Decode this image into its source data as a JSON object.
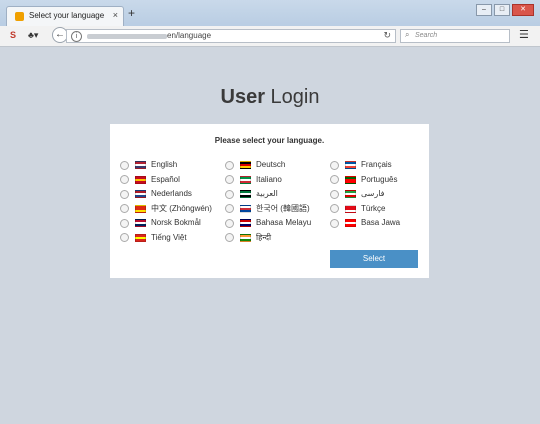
{
  "browser": {
    "tab_title": "Select your language",
    "tab_close": "×",
    "new_tab": "+",
    "url_path": "en/language",
    "search_placeholder": "Search",
    "win_min": "–",
    "win_max": "□",
    "win_close": "✕"
  },
  "page": {
    "title_bold": "User",
    "title_rest": " Login",
    "prompt": "Please select your language.",
    "select_button": "Select"
  },
  "languages": [
    {
      "label": "English",
      "flag": [
        "#b22234",
        "#ffffff",
        "#3c3b6e"
      ]
    },
    {
      "label": "Español",
      "flag": [
        "#c60b1e",
        "#ffc400",
        "#c60b1e"
      ]
    },
    {
      "label": "Nederlands",
      "flag": [
        "#ae1c28",
        "#ffffff",
        "#21468b"
      ]
    },
    {
      "label": "中文 (Zhōngwén)",
      "flag": [
        "#de2910",
        "#de2910",
        "#ffde00"
      ]
    },
    {
      "label": "Norsk Bokmål",
      "flag": [
        "#ba0c2f",
        "#ffffff",
        "#00205b"
      ]
    },
    {
      "label": "Tiếng Việt",
      "flag": [
        "#da251d",
        "#ffff00",
        "#da251d"
      ]
    },
    {
      "label": "Deutsch",
      "flag": [
        "#000000",
        "#dd0000",
        "#ffce00"
      ]
    },
    {
      "label": "Italiano",
      "flag": [
        "#009246",
        "#ffffff",
        "#ce2b37"
      ]
    },
    {
      "label": "العربية",
      "flag": [
        "#007a3d",
        "#ffffff",
        "#000000"
      ]
    },
    {
      "label": "한국어 (韓國語)",
      "flag": [
        "#ffffff",
        "#cd2e3a",
        "#0047a0"
      ]
    },
    {
      "label": "Bahasa Melayu",
      "flag": [
        "#cc0001",
        "#ffffff",
        "#010066"
      ]
    },
    {
      "label": "हिन्दी",
      "flag": [
        "#ff9933",
        "#ffffff",
        "#138808"
      ]
    },
    {
      "label": "Français",
      "flag": [
        "#0055a4",
        "#ffffff",
        "#ef4135"
      ]
    },
    {
      "label": "Português",
      "flag": [
        "#006600",
        "#ff0000",
        "#ff0000"
      ]
    },
    {
      "label": "فارسی",
      "flag": [
        "#239f40",
        "#ffffff",
        "#da0000"
      ]
    },
    {
      "label": "Türkçe",
      "flag": [
        "#e30a17",
        "#e30a17",
        "#ffffff"
      ]
    },
    {
      "label": "Basa Jawa",
      "flag": [
        "#ff0000",
        "#ffffff",
        "#ff0000"
      ]
    }
  ],
  "colors": {
    "page_bg": "#cfd6df",
    "accent": "#4a90c6"
  },
  "icons": {
    "back": "back-arrow-icon",
    "reload": "reload-icon",
    "search": "search-icon",
    "menu": "hamburger-menu-icon"
  }
}
